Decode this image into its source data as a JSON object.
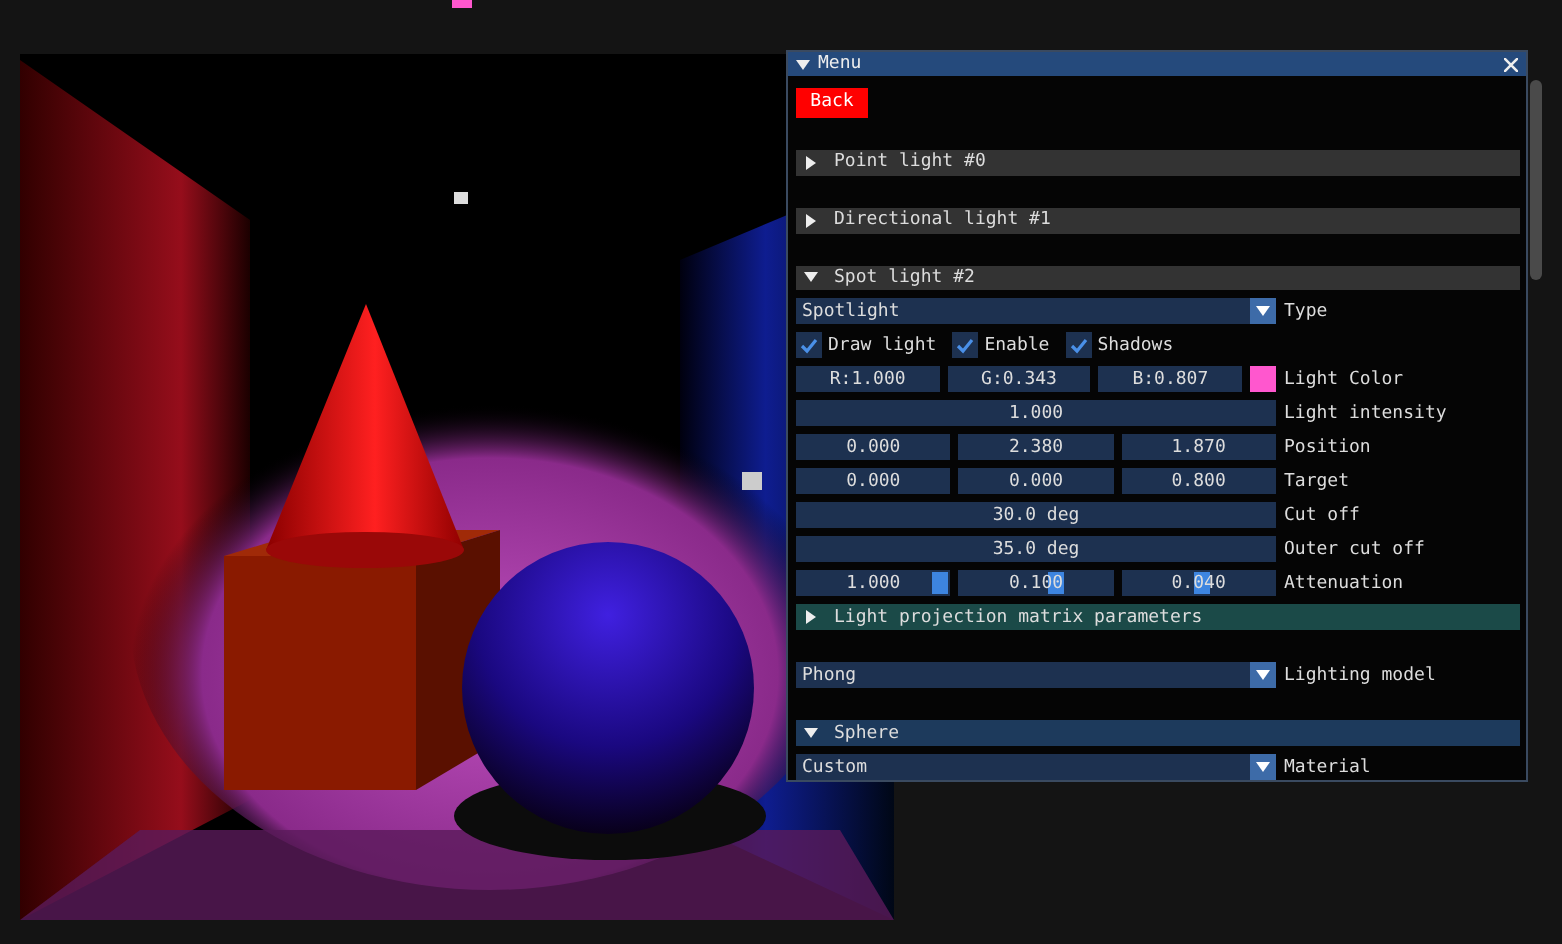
{
  "window": {
    "title": "Menu"
  },
  "items": [
    {
      "kind": "button",
      "label": "Back"
    },
    {
      "kind": "header",
      "label": "Point light #0",
      "expanded": false,
      "hovered": false,
      "selected": false
    },
    {
      "kind": "header",
      "label": "Directional light #1",
      "expanded": false,
      "hovered": false,
      "selected": false
    },
    {
      "kind": "header",
      "label": "Spot light #2",
      "expanded": true,
      "hovered": false,
      "selected": false
    },
    {
      "kind": "combo",
      "label": "Type",
      "fields": [
        {
          "value": "Spotlight"
        }
      ]
    },
    {
      "kind": "checkboxes",
      "boxes": [
        {
          "label": "Draw light",
          "checked": true
        },
        {
          "label": "Enable",
          "checked": true
        },
        {
          "label": "Shadows",
          "checked": true
        }
      ]
    },
    {
      "kind": "color",
      "label": "Light Color",
      "fields": [
        {
          "value": "R:1.000"
        },
        {
          "value": "G:0.343"
        },
        {
          "value": "B:0.807"
        }
      ],
      "color": "#ff57ce"
    },
    {
      "kind": "fields",
      "label": "Light intensity",
      "fields": [
        {
          "value": "1.000"
        }
      ]
    },
    {
      "kind": "fields",
      "label": "Position",
      "fields": [
        {
          "value": "0.000"
        },
        {
          "value": "2.380"
        },
        {
          "value": "1.870"
        }
      ]
    },
    {
      "kind": "fields",
      "label": "Target",
      "fields": [
        {
          "value": "0.000"
        },
        {
          "value": "0.000"
        },
        {
          "value": "0.800"
        }
      ]
    },
    {
      "kind": "fields",
      "label": "Cut off",
      "fields": [
        {
          "value": "30.0 deg"
        }
      ]
    },
    {
      "kind": "fields",
      "label": "Outer cut off",
      "fields": [
        {
          "value": "35.0 deg"
        }
      ]
    },
    {
      "kind": "fields",
      "label": "Attenuation",
      "fields": [
        {
          "value": "1.000",
          "level": 1
        },
        {
          "value": "0.100",
          "level": 0.66
        },
        {
          "value": "0.040",
          "level": 0.53
        }
      ]
    },
    {
      "kind": "header",
      "label": "Light projection matrix parameters",
      "expanded": false,
      "hovered": true,
      "selected": false
    },
    {
      "kind": "combo",
      "label": "Lighting model",
      "fields": [
        {
          "value": "Phong"
        }
      ]
    },
    {
      "kind": "header",
      "label": "Sphere",
      "expanded": true,
      "hovered": false,
      "selected": true
    },
    {
      "kind": "combo",
      "label": "Material",
      "fields": [
        {
          "value": "Custom"
        }
      ]
    }
  ]
}
